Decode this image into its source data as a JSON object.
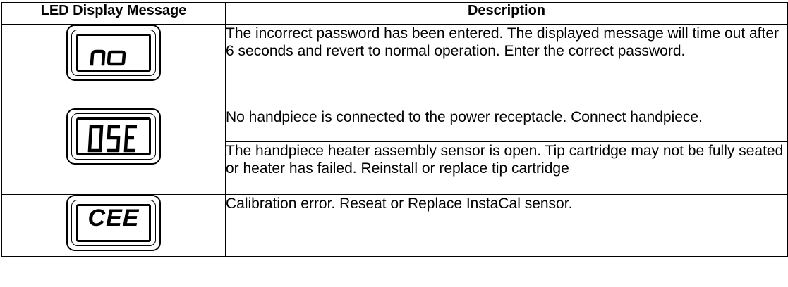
{
  "table": {
    "headers": [
      "LED Display Message",
      "Description"
    ],
    "rows": [
      {
        "led": {
          "icon": "led-display-no-icon",
          "text": "no"
        },
        "descriptions": [
          "The incorrect password has been entered.  The displayed message will time out after 6 seconds and revert to normal operation.  Enter the correct password."
        ]
      },
      {
        "led": {
          "icon": "led-display-ose-icon",
          "text": "OSE"
        },
        "descriptions": [
          "No handpiece is connected to the power receptacle.  Connect handpiece.",
          "The handpiece heater assembly sensor is open.  Tip cartridge may not be fully seated or heater has failed.  Reinstall or replace tip cartridge"
        ]
      },
      {
        "led": {
          "icon": "led-display-cee-icon",
          "text": "CEE"
        },
        "descriptions": [
          "Calibration error.  Reseat or Replace InstaCal sensor."
        ]
      }
    ]
  }
}
